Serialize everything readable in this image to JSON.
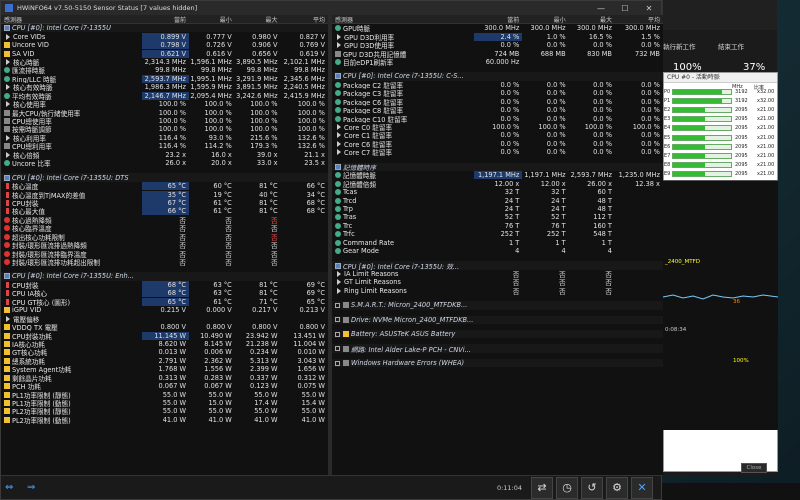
{
  "window": {
    "title": "HWiNFO64 v7.50-5150 Sensor Status [7 values hidden]"
  },
  "left": {
    "headers": [
      "感測器",
      "當前",
      "最小",
      "最大",
      "平均"
    ],
    "rows": [
      {
        "t": "grp",
        "name": "CPU [#0]: Intel Core i7-1355U",
        "ic": "chip"
      },
      {
        "name": "Core VIDs",
        "ic": "tri",
        "v": [
          "0.899 V",
          "0.777 V",
          "0.980 V",
          "0.827 V"
        ],
        "hl": true
      },
      {
        "name": "Uncore VID",
        "ic": "bolt",
        "v": [
          "0.798 V",
          "0.726 V",
          "0.906 V",
          "0.769 V"
        ],
        "hl": true
      },
      {
        "name": "SA VID",
        "ic": "bolt",
        "v": [
          "0.621 V",
          "0.616 V",
          "0.656 V",
          "0.619 V"
        ],
        "hl": true
      },
      {
        "name": "核心時脈",
        "ic": "tri",
        "v": [
          "2,314.3 MHz",
          "1,596.1 MHz",
          "3,890.5 MHz",
          "2,102.1 MHz"
        ]
      },
      {
        "name": "匯流排時脈",
        "ic": "clock",
        "v": [
          "99.8 MHz",
          "99.8 MHz",
          "99.8 MHz",
          "99.8 MHz"
        ]
      },
      {
        "name": "Ring/LLC 時脈",
        "ic": "clock",
        "v": [
          "2,593.7 MHz",
          "1,995.1 MHz",
          "3,291.9 MHz",
          "2,345.6 MHz"
        ],
        "hl": true
      },
      {
        "name": "核心有效時脈",
        "ic": "tri",
        "v": [
          "1,986.3 MHz",
          "1,595.9 MHz",
          "3,891.5 MHz",
          "2,240.5 MHz"
        ]
      },
      {
        "name": "平均有效時脈",
        "ic": "clock",
        "v": [
          "2,146.7 MHz",
          "2,095.4 MHz",
          "3,242.6 MHz",
          "2,415.9 MHz"
        ],
        "hl": true
      },
      {
        "name": "核心使用率",
        "ic": "tri",
        "v": [
          "100.0 %",
          "100.0 %",
          "100.0 %",
          "100.0 %"
        ]
      },
      {
        "name": "最大CPU/執行緒使用率",
        "ic": "disk",
        "v": [
          "100.0 %",
          "100.0 %",
          "100.0 %",
          "100.0 %"
        ]
      },
      {
        "name": "CPU總使用率",
        "ic": "disk",
        "v": [
          "100.0 %",
          "100.0 %",
          "100.0 %",
          "100.0 %"
        ]
      },
      {
        "name": "按需時脈調節",
        "ic": "disk",
        "v": [
          "100.0 %",
          "100.0 %",
          "100.0 %",
          "100.0 %"
        ]
      },
      {
        "name": "核心利用率",
        "ic": "tri",
        "v": [
          "116.4 %",
          "93.0 %",
          "215.6 %",
          "132.6 %"
        ]
      },
      {
        "name": "CPU總利用率",
        "ic": "disk",
        "v": [
          "116.4 %",
          "114.2 %",
          "179.3 %",
          "132.6 %"
        ]
      },
      {
        "name": "核心倍頻",
        "ic": "tri",
        "v": [
          "23.2 x",
          "16.0 x",
          "39.0 x",
          "21.1 x"
        ]
      },
      {
        "name": "Uncore 比率",
        "ic": "clock",
        "v": [
          "26.0 x",
          "20.0 x",
          "33.0 x",
          "23.5 x"
        ]
      },
      {
        "t": "sep"
      },
      {
        "t": "grp",
        "name": "CPU [#0]: Intel Core i7-1355U: DTS",
        "ic": "chip"
      },
      {
        "name": "核心溫度",
        "ic": "therm",
        "v": [
          "65 °C",
          "60 °C",
          "81 °C",
          "66 °C"
        ],
        "hl": true
      },
      {
        "name": "核心溫度到TjMAX的差值",
        "ic": "therm",
        "v": [
          "35 °C",
          "19 °C",
          "40 °C",
          "34 °C"
        ],
        "hl": true
      },
      {
        "name": "CPU封裝",
        "ic": "therm",
        "v": [
          "67 °C",
          "61 °C",
          "81 °C",
          "68 °C"
        ],
        "hl": true
      },
      {
        "name": "核心最大值",
        "ic": "therm",
        "v": [
          "66 °C",
          "61 °C",
          "81 °C",
          "68 °C"
        ],
        "hl": true
      },
      {
        "name": "核心過熱降頻",
        "ic": "circ",
        "v": [
          "否",
          "否",
          "否",
          ""
        ],
        "alt": [
          false,
          false,
          true,
          false
        ]
      },
      {
        "name": "核心臨界溫度",
        "ic": "circ",
        "v": [
          "否",
          "否",
          "否",
          ""
        ]
      },
      {
        "name": "超出核心功耗限制",
        "ic": "circ",
        "v": [
          "否",
          "否",
          "否",
          ""
        ],
        "alt": [
          false,
          false,
          true,
          false
        ]
      },
      {
        "name": "封裝/環形匯流排過熱降頻",
        "ic": "circ",
        "v": [
          "否",
          "否",
          "否",
          ""
        ]
      },
      {
        "name": "封裝/環形匯流排臨界溫度",
        "ic": "circ",
        "v": [
          "否",
          "否",
          "否",
          ""
        ]
      },
      {
        "name": "封裝/環形匯流排功耗超出限制",
        "ic": "circ",
        "v": [
          "否",
          "否",
          "否",
          ""
        ]
      },
      {
        "t": "sep"
      },
      {
        "t": "grp",
        "name": "CPU [#0]: Intel Core i7-1355U: Enh...",
        "ic": "chip"
      },
      {
        "name": "CPU封裝",
        "ic": "therm",
        "v": [
          "68 °C",
          "63 °C",
          "81 °C",
          "69 °C"
        ],
        "hl": true
      },
      {
        "name": "CPU IA核心",
        "ic": "therm",
        "v": [
          "68 °C",
          "63 °C",
          "81 °C",
          "69 °C"
        ],
        "hl": true
      },
      {
        "name": "CPU GT核心 (圖形)",
        "ic": "therm",
        "v": [
          "65 °C",
          "61 °C",
          "71 °C",
          "65 °C"
        ],
        "hl": true
      },
      {
        "name": "iGPU VID",
        "ic": "bolt",
        "v": [
          "0.215 V",
          "0.000 V",
          "0.217 V",
          "0.213 V"
        ]
      },
      {
        "name": "電壓偏移",
        "ic": "tri",
        "v": [
          "",
          "",
          "",
          ""
        ]
      },
      {
        "name": "VDDQ TX 電壓",
        "ic": "bolt",
        "v": [
          "0.800 V",
          "0.800 V",
          "0.800 V",
          "0.800 V"
        ]
      },
      {
        "name": "CPU封裝功耗",
        "ic": "bolt",
        "v": [
          "11.145 W",
          "10.490 W",
          "23.942 W",
          "13.451 W"
        ],
        "hl": true
      },
      {
        "name": "IA核心功耗",
        "ic": "bolt",
        "v": [
          "8.620 W",
          "8.145 W",
          "21.238 W",
          "11.004 W"
        ]
      },
      {
        "name": "GT核心功耗",
        "ic": "bolt",
        "v": [
          "0.013 W",
          "0.006 W",
          "0.234 W",
          "0.010 W"
        ]
      },
      {
        "name": "總系統功耗",
        "ic": "bolt",
        "v": [
          "2.791 W",
          "2.362 W",
          "5.313 W",
          "3.043 W"
        ]
      },
      {
        "name": "System Agent功耗",
        "ic": "bolt",
        "v": [
          "1.768 W",
          "1.556 W",
          "2.399 W",
          "1.656 W"
        ]
      },
      {
        "name": "剩餘晶片功耗",
        "ic": "bolt",
        "v": [
          "0.313 W",
          "0.283 W",
          "0.337 W",
          "0.312 W"
        ]
      },
      {
        "name": "PCH 功耗",
        "ic": "bolt",
        "v": [
          "0.067 W",
          "0.067 W",
          "0.123 W",
          "0.075 W"
        ]
      },
      {
        "name": "PL1功率限制 (靜態)",
        "ic": "bolt",
        "v": [
          "55.0 W",
          "55.0 W",
          "55.0 W",
          "55.0 W"
        ]
      },
      {
        "name": "PL1功率限制 (動態)",
        "ic": "bolt",
        "v": [
          "55.0 W",
          "15.0 W",
          "17.4 W",
          "15.4 W"
        ]
      },
      {
        "name": "PL2功率限制 (靜態)",
        "ic": "bolt",
        "v": [
          "55.0 W",
          "55.0 W",
          "55.0 W",
          "55.0 W"
        ]
      },
      {
        "name": "PL2功率限制 (動態)",
        "ic": "bolt",
        "v": [
          "41.0 W",
          "41.0 W",
          "41.0 W",
          "41.0 W"
        ]
      }
    ]
  },
  "right": {
    "headers": [
      "感測器",
      "當前",
      "最小",
      "最大",
      "平均"
    ],
    "rows": [
      {
        "name": "GPU時脈",
        "ic": "clock",
        "v": [
          "300.0 MHz",
          "300.0 MHz",
          "300.0 MHz",
          "300.0 MHz"
        ]
      },
      {
        "name": "GPU D3D利用率",
        "ic": "tri",
        "v": [
          "2.4 %",
          "1.0 %",
          "16.5 %",
          "1.5 %"
        ],
        "hl": true
      },
      {
        "name": "GPU D3D使用率",
        "ic": "tri",
        "v": [
          "0.0 %",
          "0.0 %",
          "0.0 %",
          "0.0 %"
        ]
      },
      {
        "name": "GPU D3D共用記憶體",
        "ic": "disk",
        "v": [
          "724 MB",
          "688 MB",
          "830 MB",
          "732 MB"
        ]
      },
      {
        "name": "目前eDP1刷新率",
        "ic": "clock",
        "v": [
          "60.000 Hz",
          "",
          "",
          ""
        ]
      },
      {
        "t": "sep"
      },
      {
        "t": "grp",
        "name": "CPU [#0]: Intel Core i7-1355U: C-S...",
        "ic": "chip"
      },
      {
        "name": "Package C2 駐留率",
        "ic": "clock",
        "v": [
          "0.0 %",
          "0.0 %",
          "0.0 %",
          "0.0 %"
        ]
      },
      {
        "name": "Package C3 駐留率",
        "ic": "clock",
        "v": [
          "0.0 %",
          "0.0 %",
          "0.0 %",
          "0.0 %"
        ]
      },
      {
        "name": "Package C6 駐留率",
        "ic": "clock",
        "v": [
          "0.0 %",
          "0.0 %",
          "0.0 %",
          "0.0 %"
        ]
      },
      {
        "name": "Package C8 駐留率",
        "ic": "clock",
        "v": [
          "0.0 %",
          "0.0 %",
          "0.0 %",
          "0.0 %"
        ]
      },
      {
        "name": "Package C10 駐留率",
        "ic": "clock",
        "v": [
          "0.0 %",
          "0.0 %",
          "0.0 %",
          "0.0 %"
        ]
      },
      {
        "name": "Core C0 駐留率",
        "ic": "tri",
        "v": [
          "100.0 %",
          "100.0 %",
          "100.0 %",
          "100.0 %"
        ]
      },
      {
        "name": "Core C1 駐留率",
        "ic": "tri",
        "v": [
          "0.0 %",
          "0.0 %",
          "0.0 %",
          "0.0 %"
        ]
      },
      {
        "name": "Core C6 駐留率",
        "ic": "tri",
        "v": [
          "0.0 %",
          "0.0 %",
          "0.0 %",
          "0.0 %"
        ]
      },
      {
        "name": "Core C7 駐留率",
        "ic": "tri",
        "v": [
          "0.0 %",
          "0.0 %",
          "0.0 %",
          "0.0 %"
        ]
      },
      {
        "t": "sep"
      },
      {
        "t": "grp",
        "name": "記憶體時序",
        "ic": "chip"
      },
      {
        "name": "記憶體時脈",
        "ic": "clock",
        "v": [
          "1,197.1 MHz",
          "1,197.1 MHz",
          "2,593.7 MHz",
          "1,235.0 MHz"
        ],
        "hl": true
      },
      {
        "name": "記憶體倍頻",
        "ic": "clock",
        "v": [
          "12.00 x",
          "12.00 x",
          "26.00 x",
          "12.38 x"
        ]
      },
      {
        "name": "Tcas",
        "ic": "clock",
        "v": [
          "32 T",
          "32 T",
          "60 T",
          ""
        ]
      },
      {
        "name": "Trcd",
        "ic": "clock",
        "v": [
          "24 T",
          "24 T",
          "48 T",
          ""
        ]
      },
      {
        "name": "Trp",
        "ic": "clock",
        "v": [
          "24 T",
          "24 T",
          "48 T",
          ""
        ]
      },
      {
        "name": "Tras",
        "ic": "clock",
        "v": [
          "52 T",
          "52 T",
          "112 T",
          ""
        ]
      },
      {
        "name": "Trc",
        "ic": "clock",
        "v": [
          "76 T",
          "76 T",
          "160 T",
          ""
        ]
      },
      {
        "name": "Trfc",
        "ic": "clock",
        "v": [
          "252 T",
          "252 T",
          "548 T",
          ""
        ]
      },
      {
        "name": "Command Rate",
        "ic": "clock",
        "v": [
          "1 T",
          "1 T",
          "1 T",
          ""
        ]
      },
      {
        "name": "Gear Mode",
        "ic": "clock",
        "v": [
          "4",
          "4",
          "4",
          ""
        ]
      },
      {
        "t": "sep"
      },
      {
        "t": "grp",
        "name": "CPU [#0]: Intel Core i7-1355U: 效...",
        "ic": "chip"
      },
      {
        "name": "IA Limit Reasons",
        "ic": "tri",
        "v": [
          "否",
          "否",
          "否",
          ""
        ]
      },
      {
        "name": "GT Limit Reasons",
        "ic": "tri",
        "v": [
          "否",
          "否",
          "否",
          ""
        ]
      },
      {
        "name": "Ring Limit Reasons",
        "ic": "tri",
        "v": [
          "否",
          "否",
          "否",
          ""
        ]
      },
      {
        "t": "sep"
      },
      {
        "t": "grpc",
        "name": "S.M.A.R.T.: Micron_2400_MTFDKB...",
        "ic": "disk"
      },
      {
        "t": "sep"
      },
      {
        "t": "grpc",
        "name": "Drive: NVMe Micron_2400_MTFDKB...",
        "ic": "disk"
      },
      {
        "t": "sep"
      },
      {
        "t": "grpc",
        "name": "Battery: ASUSTeK ASUS Battery",
        "ic": "bolt"
      },
      {
        "t": "sep"
      },
      {
        "t": "grpc",
        "name": "網路: Intel Alder Lake-P PCH - CNVi...",
        "ic": "disk"
      },
      {
        "t": "sep"
      },
      {
        "t": "grpc",
        "name": "Windows Hardware Errors (WHEA)",
        "ic": "disk"
      }
    ]
  },
  "toolbar": {
    "timer": "0:11:04"
  },
  "taskmgr": {
    "run_label": "執行新工作",
    "end_label": "結束工作",
    "pct1": "100%",
    "pct2": "37%",
    "cpu_title": "CPU #0 - 活動時脈",
    "col_clock": "MHz",
    "col_ratio": "比率",
    "rows": [
      {
        "c": "P0",
        "mhz": "3192",
        "r": "x32.00",
        "f": 0.85
      },
      {
        "c": "P1",
        "mhz": "3192",
        "r": "x32.00",
        "f": 0.85
      },
      {
        "c": "E2",
        "mhz": "2095",
        "r": "x21.00",
        "f": 0.55
      },
      {
        "c": "E3",
        "mhz": "2095",
        "r": "x21.00",
        "f": 0.55
      },
      {
        "c": "E4",
        "mhz": "2095",
        "r": "x21.00",
        "f": 0.55
      },
      {
        "c": "E5",
        "mhz": "2095",
        "r": "x21.00",
        "f": 0.55
      },
      {
        "c": "E6",
        "mhz": "2095",
        "r": "x21.00",
        "f": 0.55
      },
      {
        "c": "E7",
        "mhz": "2095",
        "r": "x21.00",
        "f": 0.55
      },
      {
        "c": "E8",
        "mhz": "2095",
        "r": "x21.00",
        "f": 0.55
      },
      {
        "c": "E9",
        "mhz": "2095",
        "r": "x21.00",
        "f": 0.55
      },
      {
        "c": "E10",
        "mhz": "2095",
        "r": "x21.00",
        "f": 0.55
      },
      {
        "c": "E11",
        "mhz": "2095",
        "r": "x21.00",
        "f": 0.55
      }
    ],
    "g_drive": "_2400_MTFD",
    "g_36": "36",
    "g_time": "0:08:34",
    "g_100": "100%",
    "close": "Close"
  }
}
